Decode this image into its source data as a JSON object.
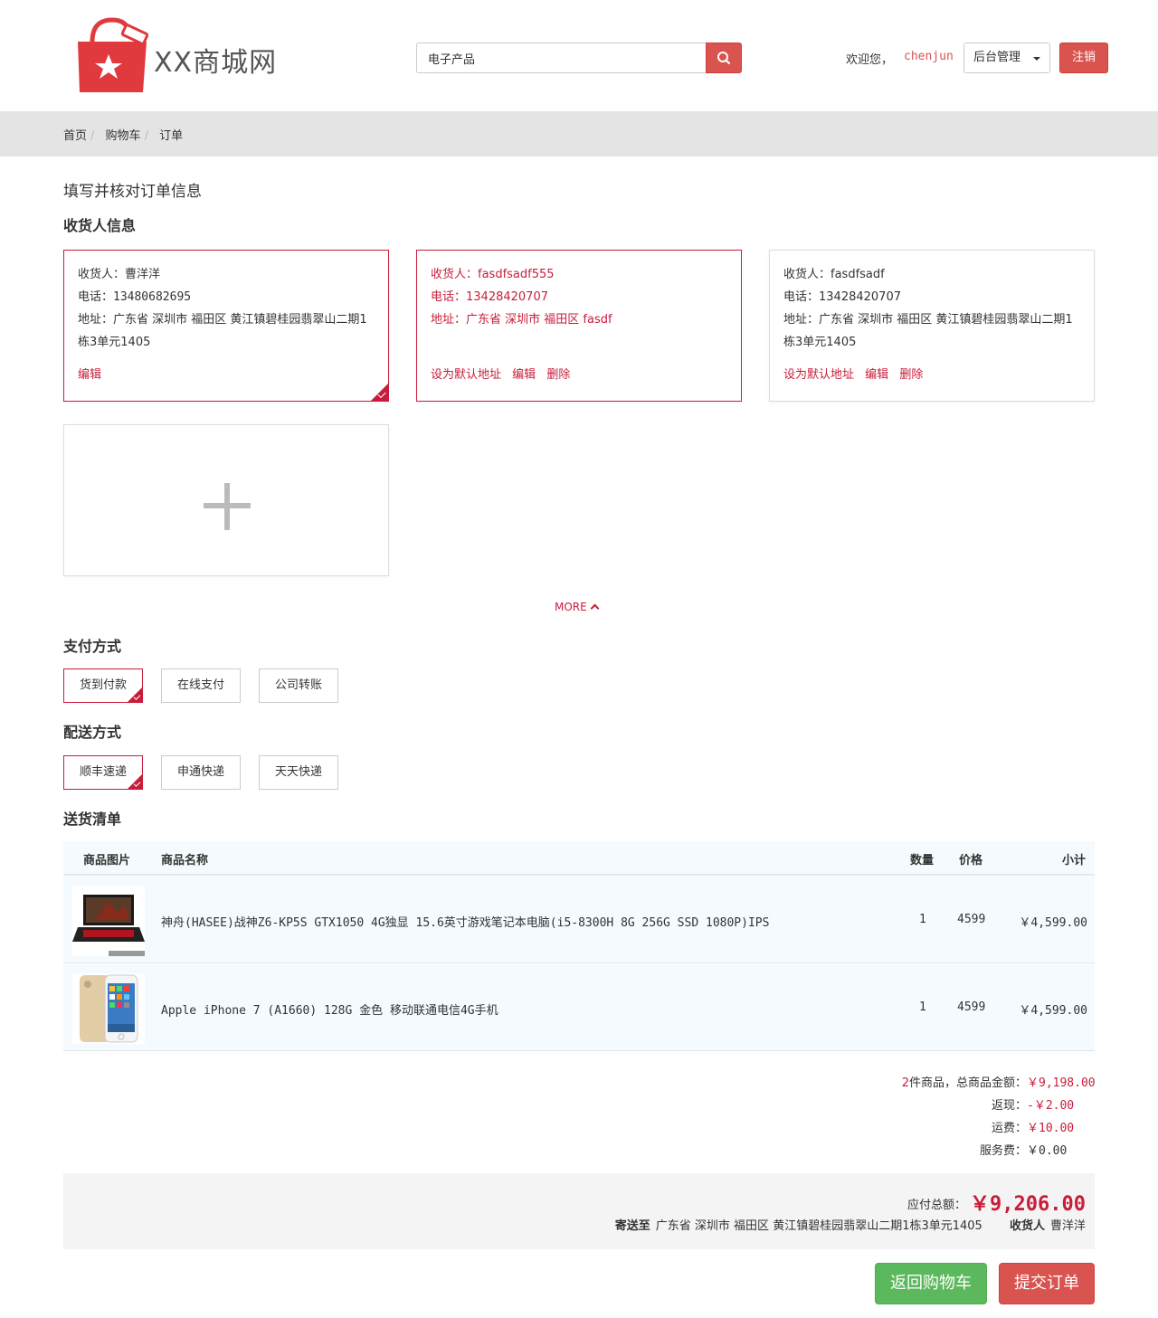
{
  "header": {
    "logo_text": "XX商城网",
    "search": {
      "value": "电子产品",
      "placeholder": ""
    },
    "welcome": "欢迎您，",
    "username": "chenjun",
    "admin_label": "后台管理",
    "logout_label": "注销"
  },
  "breadcrumb": [
    "首页",
    "购物车",
    "订单"
  ],
  "page_title": "填写并核对订单信息",
  "sections": {
    "receiver": "收货人信息",
    "payment": "支付方式",
    "delivery": "配送方式",
    "list": "送货清单"
  },
  "addresses": [
    {
      "name_line": "收货人：曹洋洋",
      "phone_line": "电话：13480682695",
      "addr_line": "地址：广东省 深圳市 福田区 黄江镇碧桂园翡翠山二期1栋3单元1405",
      "actions": [
        "编辑"
      ],
      "selected": true
    },
    {
      "name_line": "收货人：fasdfsadf555",
      "phone_line": "电话：13428420707",
      "addr_line": "地址：广东省 深圳市 福田区 fasdf",
      "actions": [
        "设为默认地址",
        "编辑",
        "删除"
      ],
      "selected": false
    },
    {
      "name_line": "收货人：fasdfsadf",
      "phone_line": "电话：13428420707",
      "addr_line": "地址：广东省 深圳市 福田区 黄江镇碧桂园翡翠山二期1栋3单元1405",
      "actions": [
        "设为默认地址",
        "编辑",
        "删除"
      ],
      "selected": false
    }
  ],
  "more_label": "MORE",
  "payment_options": [
    "货到付款",
    "在线支付",
    "公司转账"
  ],
  "payment_selected": 0,
  "delivery_options": [
    "顺丰速递",
    "申通快递",
    "天天快递"
  ],
  "delivery_selected": 0,
  "table": {
    "headers": [
      "商品图片",
      "商品名称",
      "数量",
      "价格",
      "小计"
    ],
    "rows": [
      {
        "image": "laptop-image",
        "name": "神舟(HASEE)战神Z6-KP5S GTX1050 4G独显 15.6英寸游戏笔记本电脑(i5-8300H 8G 256G SSD 1080P)IPS",
        "qty": "1",
        "price": "4599",
        "subtotal": "￥4,599.00"
      },
      {
        "image": "iphone-image",
        "name": "Apple iPhone 7 (A1660) 128G 金色 移动联通电信4G手机",
        "qty": "1",
        "price": "4599",
        "subtotal": "￥4,599.00"
      }
    ]
  },
  "summary": {
    "count": "2",
    "count_suffix": "件商品，总商品金额：",
    "goods_total": "￥9,198.00",
    "cashback_label": "返现：",
    "cashback": "-￥2.00",
    "freight_label": "运费：",
    "freight": "￥10.00",
    "service_label": "服务费：",
    "service": "￥0.00"
  },
  "total": {
    "label": "应付总额：",
    "amount": "￥9,206.00",
    "ship_to_label": "寄送至",
    "ship_to": "广东省 深圳市 福田区 黄江镇碧桂园翡翠山二期1栋3单元1405",
    "receiver_label": "收货人",
    "receiver": "曹洋洋"
  },
  "buttons": {
    "back": "返回购物车",
    "submit": "提交订单"
  },
  "colors": {
    "accent": "#c81d3a",
    "danger": "#d9534f",
    "success": "#5cb85c"
  }
}
